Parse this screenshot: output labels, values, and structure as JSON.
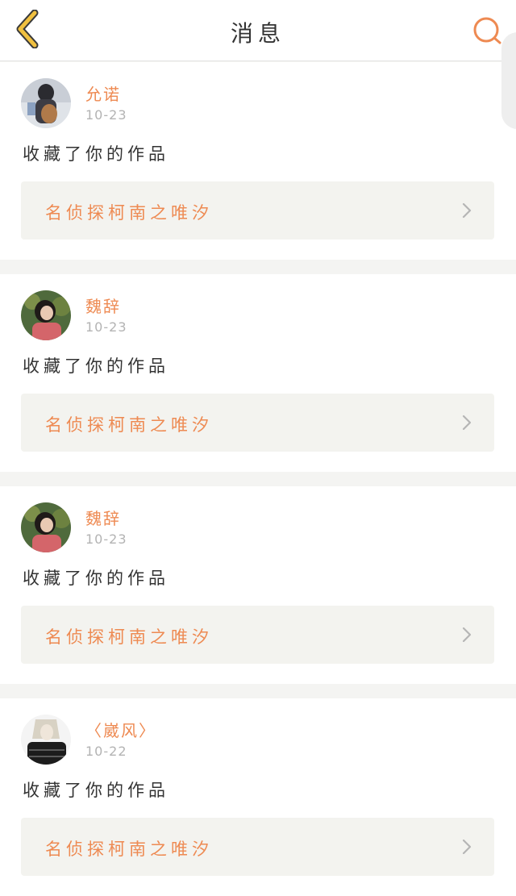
{
  "header": {
    "title": "消息",
    "back_icon": "chevron-left-icon",
    "search_icon": "search-icon",
    "accent_color": "#f0c040",
    "search_color": "#ee8a52"
  },
  "messages": [
    {
      "username": "允诺",
      "time": "10-23",
      "action": "收藏了你的作品",
      "work_title": "名侦探柯南之唯汐"
    },
    {
      "username": "魏辞",
      "time": "10-23",
      "action": "收藏了你的作品",
      "work_title": "名侦探柯南之唯汐"
    },
    {
      "username": "魏辞",
      "time": "10-23",
      "action": "收藏了你的作品",
      "work_title": "名侦探柯南之唯汐"
    },
    {
      "username": "〈崴风〉",
      "time": "10-22",
      "action": "收藏了你的作品",
      "work_title": "名侦探柯南之唯汐"
    }
  ]
}
